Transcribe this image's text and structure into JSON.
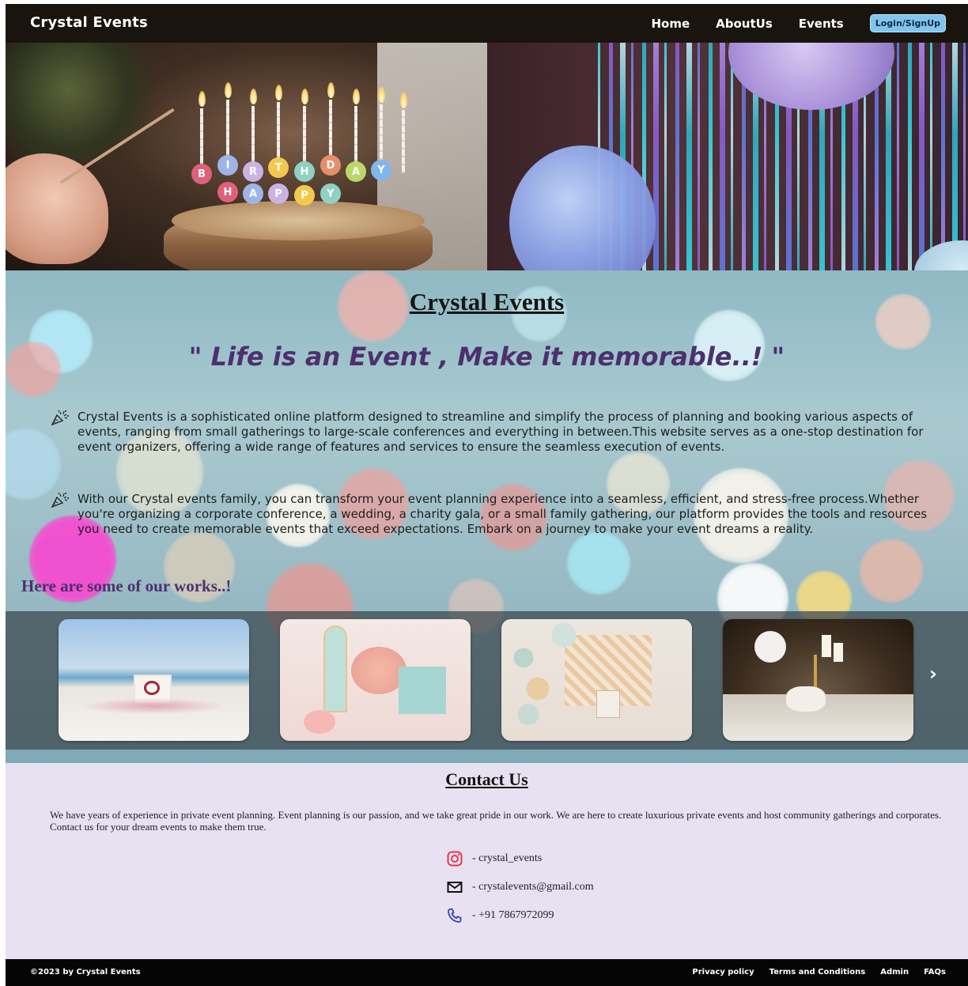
{
  "navbar": {
    "brand": "Crystal Events",
    "links": [
      "Home",
      "AboutUs",
      "Events"
    ],
    "login_label": "Login/SignUp"
  },
  "hero_images": {
    "cake_letters": [
      "B",
      "I",
      "R",
      "T",
      "H",
      "D",
      "A",
      "Y",
      "H",
      "A",
      "P",
      "P",
      "Y"
    ]
  },
  "main": {
    "title": "Crystal Events",
    "tagline": "\" Life is an Event , Make it memorable..! \"",
    "paragraphs": [
      "Crystal Events is a sophisticated online platform designed to streamline and simplify the process of planning and booking various aspects of events, ranging from small gatherings to large-scale conferences and everything in between.This website serves as a one-stop destination for event organizers, offering a wide range of features and services to ensure the seamless execution of events.",
      "With our Crystal events family, you can transform your event planning experience into a seamless, efficient, and stress-free process.Whether you're organizing a corporate conference, a wedding, a charity gala, or a small family gathering, our platform provides the tools and resources you need to create memorable events that exceed expectations. Embark on a journey to make your event dreams a reality."
    ],
    "works_heading": "Here are some of our works..!",
    "next_arrow": "›"
  },
  "contact": {
    "title": "Contact Us",
    "text": "We have years of experience in private event planning. Event planning is our passion, and we take great pride in our work. We are here to create luxurious private events and host community gatherings and corporates. Contact us for your dream events to make them true.",
    "instagram": "- crystal_events",
    "email": "- crystalevents@gmail.com",
    "phone": "- +91 7867972099"
  },
  "footer": {
    "copyright": "©2023 by Crystal Events",
    "links": [
      "Privacy policy",
      "Terms and Conditions",
      "Admin",
      "FAQs"
    ]
  },
  "colors": {
    "navbar_bg": "#1a140f",
    "accent_purple": "#4d2f6e",
    "login_button": "#7fc6ef",
    "contact_bg": "#e7e1f1",
    "footer_bg": "#050505"
  },
  "icons": [
    "party-popper-icon",
    "instagram-icon",
    "mail-icon",
    "phone-icon",
    "chevron-right-icon"
  ]
}
